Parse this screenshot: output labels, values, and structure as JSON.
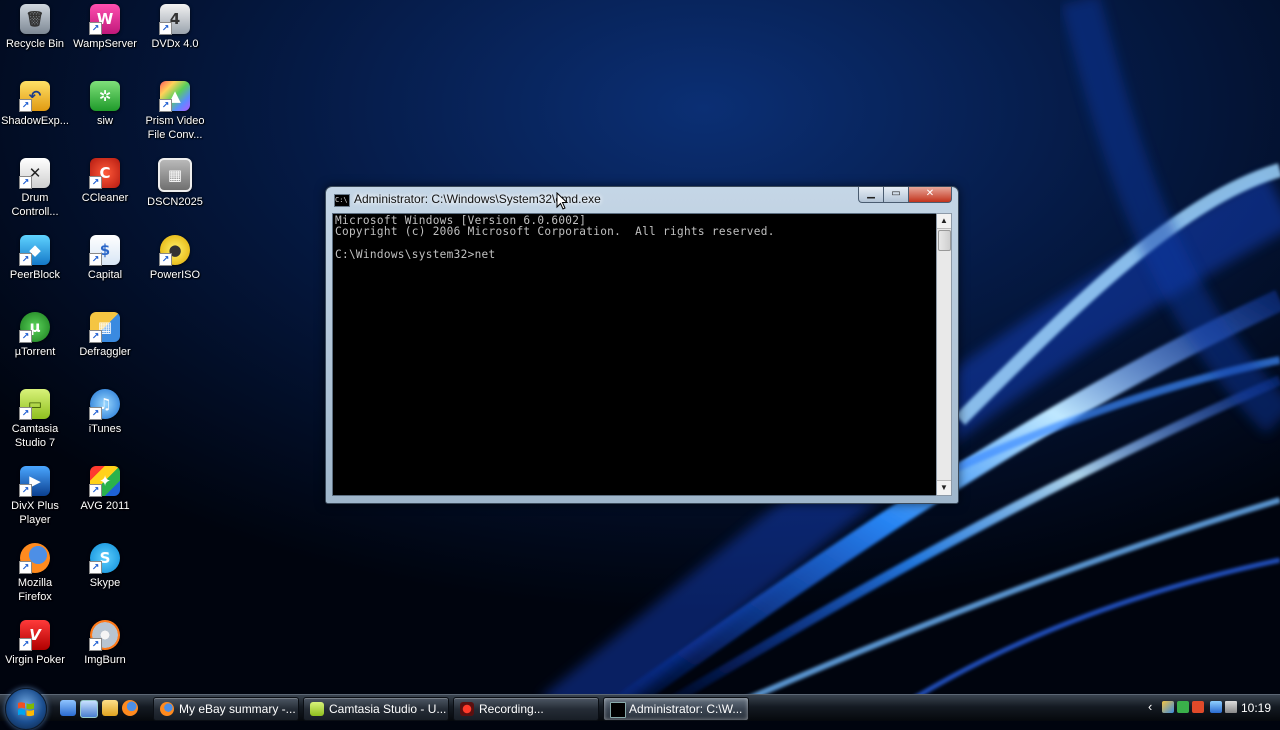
{
  "desktop": {
    "icons": [
      {
        "label": "Recycle Bin",
        "icon": "recycle-bin-icon"
      },
      {
        "label": "WampServer",
        "icon": "wampserver-icon"
      },
      {
        "label": "DVDx 4.0",
        "icon": "dvdx-icon"
      },
      {
        "label": "ShadowExp...",
        "icon": "shadowexplorer-icon"
      },
      {
        "label": "siw",
        "icon": "siw-icon"
      },
      {
        "label": "Prism Video File Conv...",
        "icon": "prism-icon"
      },
      {
        "label": "Drum Controll...",
        "icon": "drum-controller-icon"
      },
      {
        "label": "CCleaner",
        "icon": "ccleaner-icon"
      },
      {
        "label": "DSCN2025",
        "icon": "image-file-icon"
      },
      {
        "label": "PeerBlock",
        "icon": "peerblock-icon"
      },
      {
        "label": "Capital",
        "icon": "capital-icon"
      },
      {
        "label": "PowerISO",
        "icon": "poweriso-icon"
      },
      {
        "label": "µTorrent",
        "icon": "utorrent-icon"
      },
      {
        "label": "Defraggler",
        "icon": "defraggler-icon"
      },
      {
        "label": "Camtasia Studio 7",
        "icon": "camtasia-icon"
      },
      {
        "label": "iTunes",
        "icon": "itunes-icon"
      },
      {
        "label": "DivX Plus Player",
        "icon": "divx-icon"
      },
      {
        "label": "AVG 2011",
        "icon": "avg-icon"
      },
      {
        "label": "Mozilla Firefox",
        "icon": "firefox-icon"
      },
      {
        "label": "Skype",
        "icon": "skype-icon"
      },
      {
        "label": "Virgin Poker",
        "icon": "virgin-poker-icon"
      },
      {
        "label": "ImgBurn",
        "icon": "imgburn-icon"
      }
    ]
  },
  "cmd_window": {
    "title": "Administrator: C:\\Windows\\System32\\cmd.exe",
    "app_icon_text": "C:\\",
    "lines": [
      "Microsoft Windows [Version 6.0.6002]",
      "Copyright (c) 2006 Microsoft Corporation.  All rights reserved.",
      "",
      "C:\\Windows\\system32>net"
    ],
    "buttons": {
      "minimize": "▁",
      "maximize": "▭",
      "close": "✕"
    }
  },
  "taskbar": {
    "quick_launch": [
      "show-desktop-icon",
      "switch-windows-icon",
      "folder-icon",
      "firefox-icon"
    ],
    "buttons": [
      {
        "label": "My eBay summary -...",
        "icon": "firefox-icon"
      },
      {
        "label": "Camtasia Studio - U...",
        "icon": "camtasia-icon"
      },
      {
        "label": "Recording...",
        "icon": "recording-icon"
      },
      {
        "label": "Administrator: C:\\W...",
        "icon": "cmd-icon"
      }
    ],
    "tray": {
      "chevron": "‹",
      "clock": "10:19"
    }
  }
}
